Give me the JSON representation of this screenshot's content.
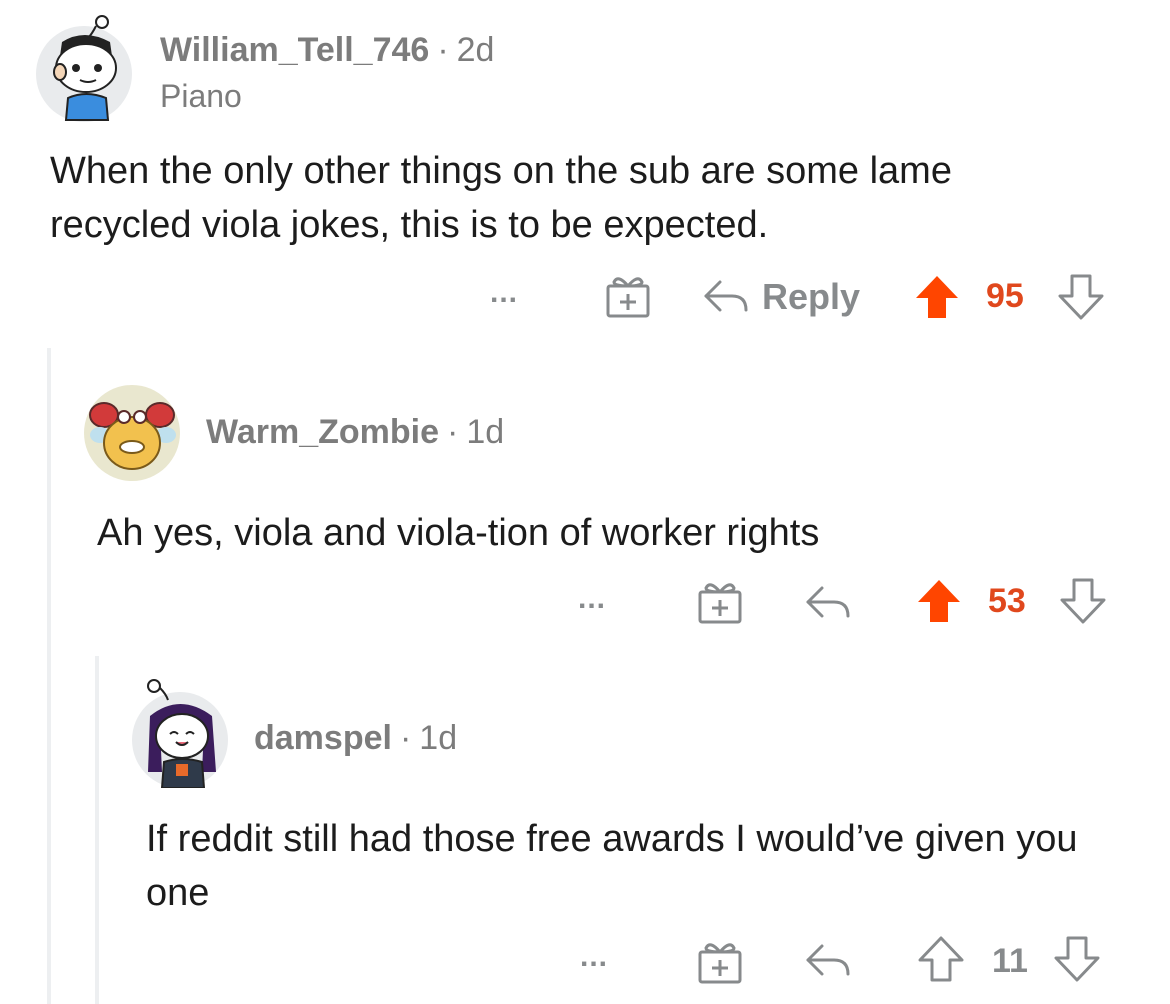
{
  "comments": [
    {
      "username": "William_Tell_746",
      "age": "2d",
      "flair": "Piano",
      "text": "When the only other things on the sub are some lame recycled viola jokes, this is to be expected.",
      "more": "...",
      "reply_label": "Reply",
      "score": "95",
      "vote_state": "upvoted"
    },
    {
      "username": "Warm_Zombie",
      "age": "1d",
      "text": "Ah yes, viola and viola-tion of worker rights",
      "more": "...",
      "score": "53",
      "vote_state": "upvoted"
    },
    {
      "username": "damspel",
      "age": "1d",
      "text": "If reddit still had those free awards I would’ve given you one",
      "more": "...",
      "score": "11",
      "vote_state": "none"
    }
  ],
  "colors": {
    "upvote_active": "#ff4500",
    "score_active": "#e0481d",
    "icon_gray": "#878a8c",
    "username_gray": "#7c7c7c",
    "text": "#1c1c1c",
    "thread_line": "#edeff1"
  }
}
